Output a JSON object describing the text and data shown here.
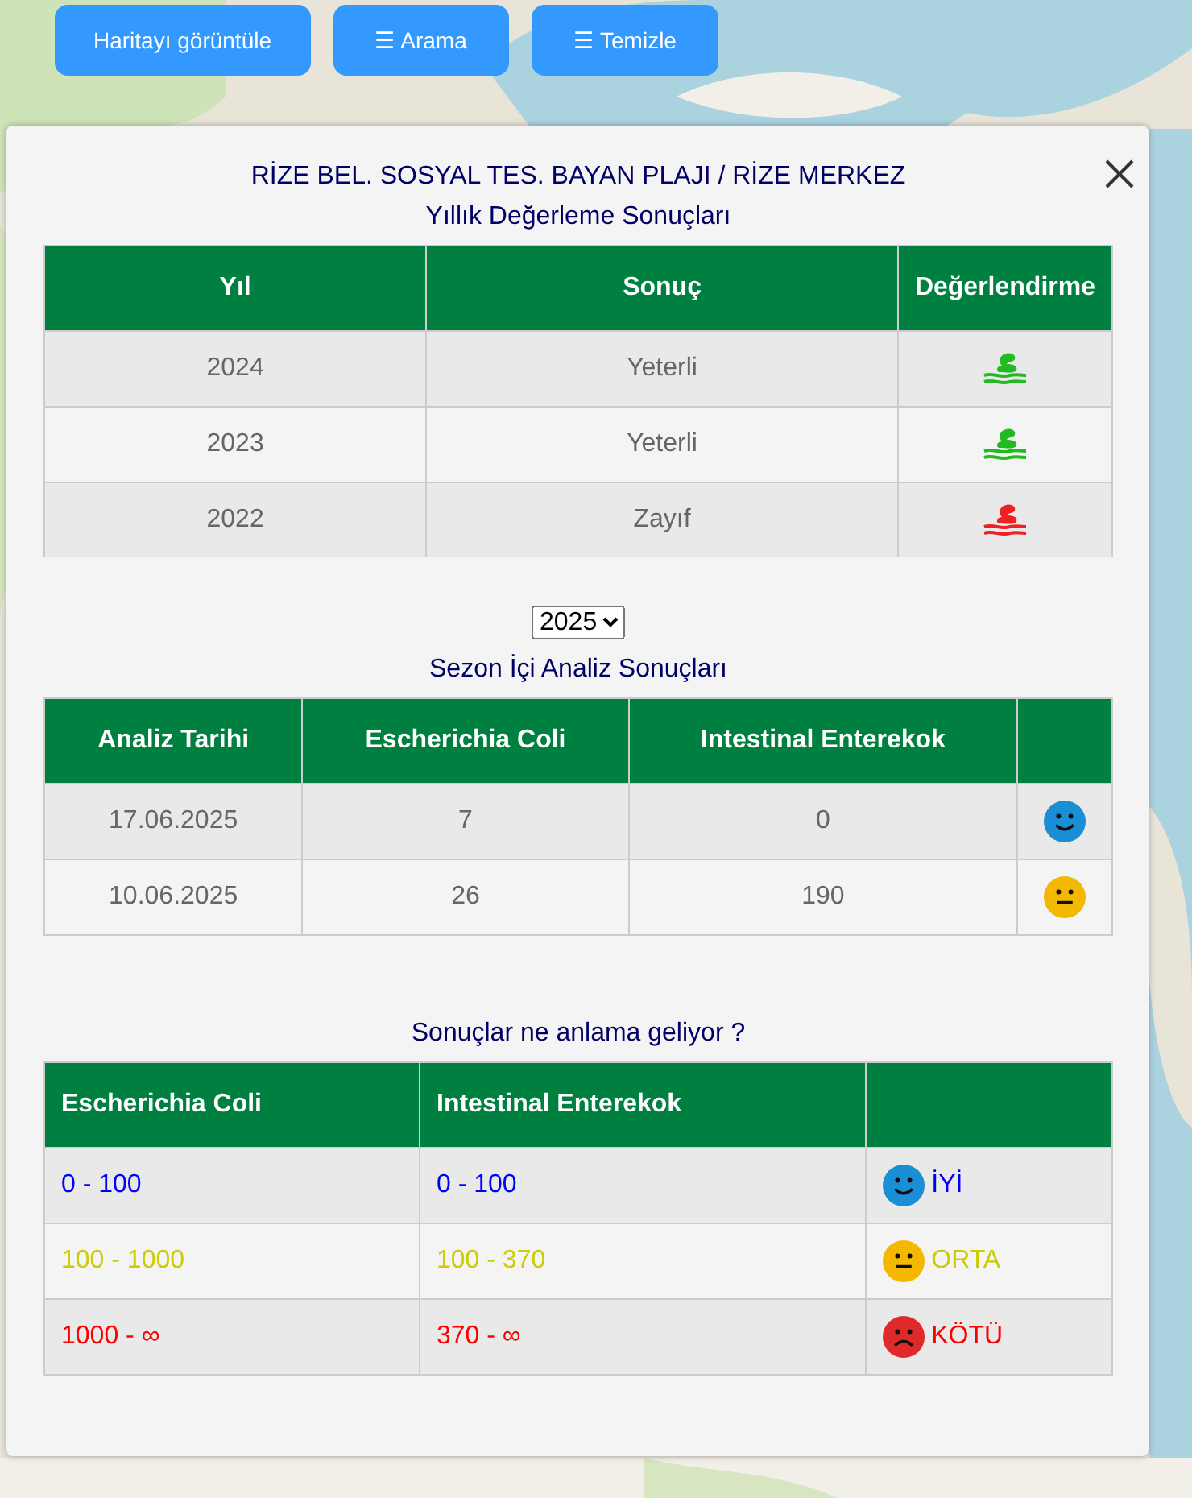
{
  "toolbar": {
    "buttons": [
      {
        "label": "Haritayı görüntüle"
      },
      {
        "label": "☰ Arama"
      },
      {
        "label": "☰ Temizle"
      }
    ]
  },
  "dialog": {
    "title": "RİZE BEL. SOSYAL TES. BAYAN PLAJI / RİZE MERKEZ",
    "yearly": {
      "heading": "Yıllık Değerleme Sonuçları",
      "columns": [
        "Yıl",
        "Sonuç",
        "Değerlendirme"
      ],
      "rows": [
        {
          "year": "2024",
          "result": "Yeterli",
          "kind": "good"
        },
        {
          "year": "2023",
          "result": "Yeterli",
          "kind": "good"
        },
        {
          "year": "2022",
          "result": "Zayıf",
          "kind": "poor"
        }
      ]
    },
    "year_select": {
      "value": "2025"
    },
    "season": {
      "heading": "Sezon İçi Analiz Sonuçları",
      "columns": [
        "Analiz Tarihi",
        "Escherichia Coli",
        "Intestinal Enterekok"
      ],
      "rows": [
        {
          "date": "17.06.2025",
          "ecoli": "7",
          "enterokok": "0",
          "kind": "good"
        },
        {
          "date": "10.06.2025",
          "ecoli": "26",
          "enterokok": "190",
          "kind": "medium"
        }
      ]
    },
    "legend": {
      "heading": "Sonuçlar ne anlama geliyor ?",
      "columns": [
        "Escherichia Coli",
        "Intestinal Enterekok"
      ],
      "rows": [
        {
          "ecoli": "0 - 100",
          "enterokok": "0 - 100",
          "kind": "good",
          "label": "İYİ",
          "color": "#0000ff"
        },
        {
          "ecoli": "100 - 1000",
          "enterokok": "100 - 370",
          "kind": "medium",
          "label": "ORTA",
          "color": "#cccc00"
        },
        {
          "ecoli": "1000 - ∞",
          "enterokok": "370 - ∞",
          "kind": "bad",
          "label": "KÖTÜ",
          "color": "#ff0000"
        }
      ]
    }
  }
}
